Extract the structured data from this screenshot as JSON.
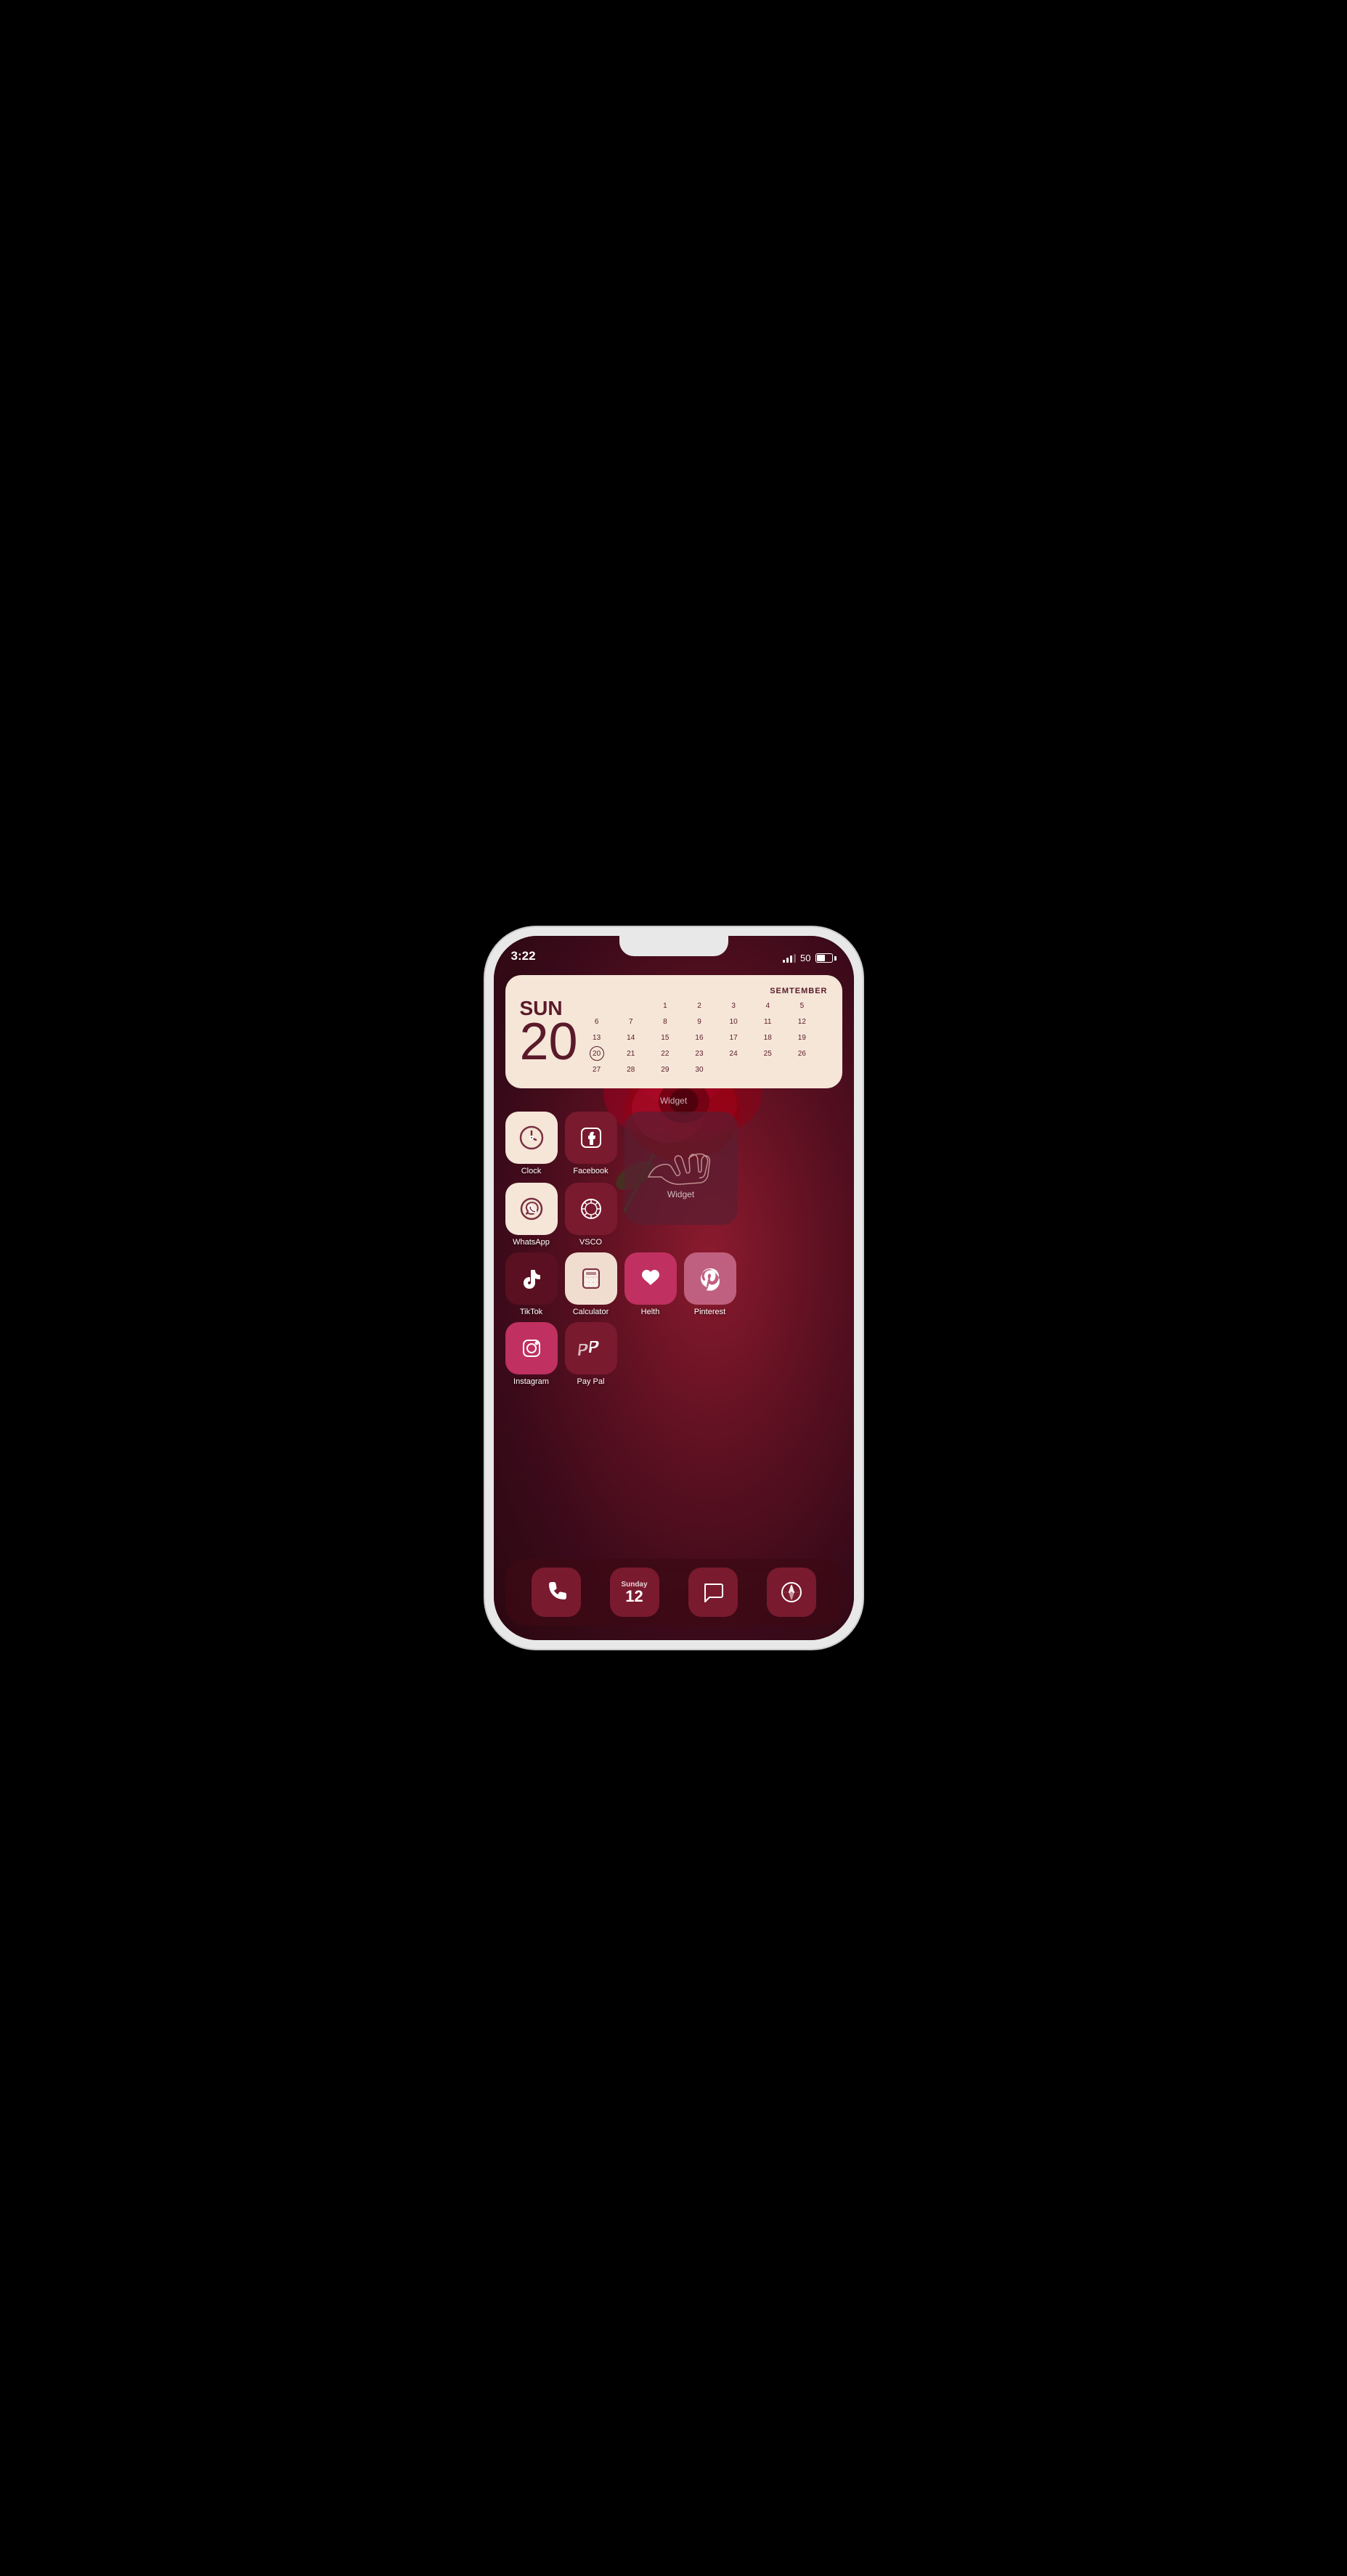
{
  "phone": {
    "status": {
      "time": "3:22",
      "battery": "50",
      "signal": 3
    },
    "calendar_widget": {
      "day_name": "SUN",
      "day_number": "20",
      "month": "SEMTEMBER",
      "label": "Widget",
      "dates": [
        [
          "",
          "",
          "1",
          "2",
          "3",
          "4",
          "5"
        ],
        [
          "6",
          "7",
          "8",
          "9",
          "10",
          "11",
          "12"
        ],
        [
          "13",
          "14",
          "15",
          "16",
          "17",
          "18",
          "19"
        ],
        [
          "20",
          "21",
          "22",
          "23",
          "24",
          "25",
          "26"
        ],
        [
          "27",
          "28",
          "29",
          "30",
          "",
          "",
          ""
        ]
      ]
    },
    "apps_row1_label": "Widget",
    "apps": {
      "clock": {
        "label": "Clock"
      },
      "facebook": {
        "label": "Facebook"
      },
      "whatsapp": {
        "label": "WhatsApp"
      },
      "vsco": {
        "label": "VSCO"
      },
      "tiktok": {
        "label": "TikTok"
      },
      "calculator": {
        "label": "Calculator"
      },
      "health": {
        "label": "Helth"
      },
      "pinterest": {
        "label": "Pinterest"
      },
      "instagram": {
        "label": "Instagram"
      },
      "paypal": {
        "label": "Pay Pal"
      }
    },
    "dock": {
      "phone_label": "Phone",
      "calendar_day": "Sunday",
      "calendar_num": "12",
      "messages_label": "Messages",
      "safari_label": "Safari"
    }
  }
}
